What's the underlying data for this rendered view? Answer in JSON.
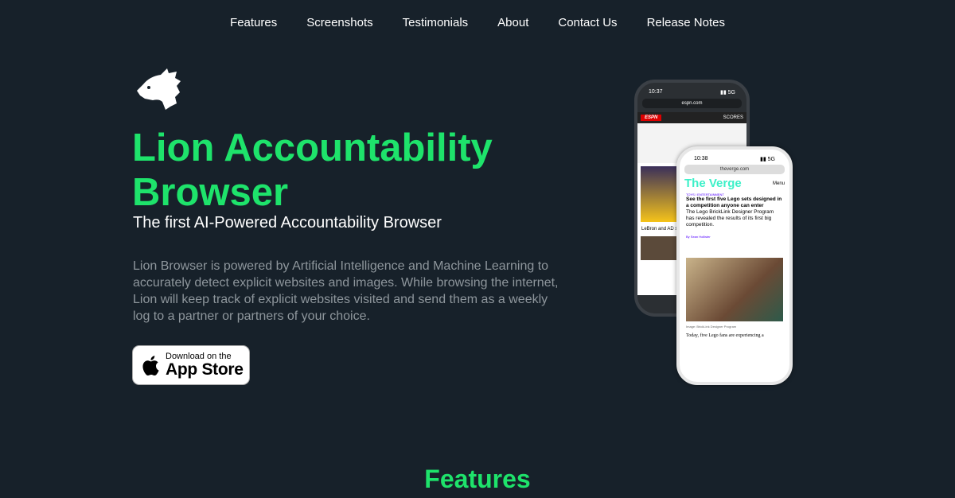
{
  "nav": [
    "Features",
    "Screenshots",
    "Testimonials",
    "About",
    "Contact Us",
    "Release Notes"
  ],
  "hero": {
    "title": "Lion Accountability Browser",
    "subtitle": "The first AI-Powered Accountability Browser",
    "description": "Lion Browser is powered by Artificial Intelligence and Machine Learning to accurately detect explicit websites and images. While browsing the internet, Lion will keep track of explicit websites visited and send them as a weekly log to a partner or partners of your choice.",
    "appstore": {
      "line1": "Download on the",
      "line2": "App Store"
    }
  },
  "phone1": {
    "time": "10:37",
    "url": "espn.com",
    "brand": "ESPN",
    "scores": "SCORES",
    "headline": "LeBron and AD set to take Game 4"
  },
  "phone2": {
    "time": "10:38",
    "url": "theverge.com",
    "brand": "The Verge",
    "menu": "Menu",
    "category": "TOYS / ENTERTAINMENT",
    "headline": "See the first five Lego sets designed in a competition anyone can enter",
    "dek": "The Lego BrickLink Designer Program has revealed the results of its first big competition.",
    "byline": "By Sean Hollister",
    "caption": "Image: BrickLink Designer Program",
    "body": "Today, five Lego fans are experiencing a"
  },
  "features_heading": "Features"
}
